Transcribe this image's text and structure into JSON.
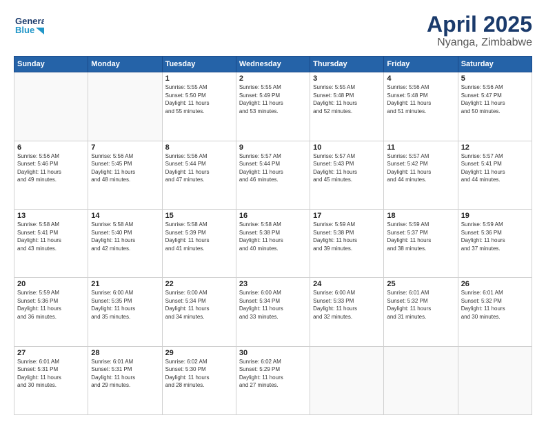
{
  "header": {
    "logo_line1": "General",
    "logo_line2": "Blue",
    "month": "April 2025",
    "location": "Nyanga, Zimbabwe"
  },
  "days_of_week": [
    "Sunday",
    "Monday",
    "Tuesday",
    "Wednesday",
    "Thursday",
    "Friday",
    "Saturday"
  ],
  "weeks": [
    [
      {
        "day": "",
        "content": ""
      },
      {
        "day": "",
        "content": ""
      },
      {
        "day": "1",
        "content": "Sunrise: 5:55 AM\nSunset: 5:50 PM\nDaylight: 11 hours\nand 55 minutes."
      },
      {
        "day": "2",
        "content": "Sunrise: 5:55 AM\nSunset: 5:49 PM\nDaylight: 11 hours\nand 53 minutes."
      },
      {
        "day": "3",
        "content": "Sunrise: 5:55 AM\nSunset: 5:48 PM\nDaylight: 11 hours\nand 52 minutes."
      },
      {
        "day": "4",
        "content": "Sunrise: 5:56 AM\nSunset: 5:48 PM\nDaylight: 11 hours\nand 51 minutes."
      },
      {
        "day": "5",
        "content": "Sunrise: 5:56 AM\nSunset: 5:47 PM\nDaylight: 11 hours\nand 50 minutes."
      }
    ],
    [
      {
        "day": "6",
        "content": "Sunrise: 5:56 AM\nSunset: 5:46 PM\nDaylight: 11 hours\nand 49 minutes."
      },
      {
        "day": "7",
        "content": "Sunrise: 5:56 AM\nSunset: 5:45 PM\nDaylight: 11 hours\nand 48 minutes."
      },
      {
        "day": "8",
        "content": "Sunrise: 5:56 AM\nSunset: 5:44 PM\nDaylight: 11 hours\nand 47 minutes."
      },
      {
        "day": "9",
        "content": "Sunrise: 5:57 AM\nSunset: 5:44 PM\nDaylight: 11 hours\nand 46 minutes."
      },
      {
        "day": "10",
        "content": "Sunrise: 5:57 AM\nSunset: 5:43 PM\nDaylight: 11 hours\nand 45 minutes."
      },
      {
        "day": "11",
        "content": "Sunrise: 5:57 AM\nSunset: 5:42 PM\nDaylight: 11 hours\nand 44 minutes."
      },
      {
        "day": "12",
        "content": "Sunrise: 5:57 AM\nSunset: 5:41 PM\nDaylight: 11 hours\nand 44 minutes."
      }
    ],
    [
      {
        "day": "13",
        "content": "Sunrise: 5:58 AM\nSunset: 5:41 PM\nDaylight: 11 hours\nand 43 minutes."
      },
      {
        "day": "14",
        "content": "Sunrise: 5:58 AM\nSunset: 5:40 PM\nDaylight: 11 hours\nand 42 minutes."
      },
      {
        "day": "15",
        "content": "Sunrise: 5:58 AM\nSunset: 5:39 PM\nDaylight: 11 hours\nand 41 minutes."
      },
      {
        "day": "16",
        "content": "Sunrise: 5:58 AM\nSunset: 5:38 PM\nDaylight: 11 hours\nand 40 minutes."
      },
      {
        "day": "17",
        "content": "Sunrise: 5:59 AM\nSunset: 5:38 PM\nDaylight: 11 hours\nand 39 minutes."
      },
      {
        "day": "18",
        "content": "Sunrise: 5:59 AM\nSunset: 5:37 PM\nDaylight: 11 hours\nand 38 minutes."
      },
      {
        "day": "19",
        "content": "Sunrise: 5:59 AM\nSunset: 5:36 PM\nDaylight: 11 hours\nand 37 minutes."
      }
    ],
    [
      {
        "day": "20",
        "content": "Sunrise: 5:59 AM\nSunset: 5:36 PM\nDaylight: 11 hours\nand 36 minutes."
      },
      {
        "day": "21",
        "content": "Sunrise: 6:00 AM\nSunset: 5:35 PM\nDaylight: 11 hours\nand 35 minutes."
      },
      {
        "day": "22",
        "content": "Sunrise: 6:00 AM\nSunset: 5:34 PM\nDaylight: 11 hours\nand 34 minutes."
      },
      {
        "day": "23",
        "content": "Sunrise: 6:00 AM\nSunset: 5:34 PM\nDaylight: 11 hours\nand 33 minutes."
      },
      {
        "day": "24",
        "content": "Sunrise: 6:00 AM\nSunset: 5:33 PM\nDaylight: 11 hours\nand 32 minutes."
      },
      {
        "day": "25",
        "content": "Sunrise: 6:01 AM\nSunset: 5:32 PM\nDaylight: 11 hours\nand 31 minutes."
      },
      {
        "day": "26",
        "content": "Sunrise: 6:01 AM\nSunset: 5:32 PM\nDaylight: 11 hours\nand 30 minutes."
      }
    ],
    [
      {
        "day": "27",
        "content": "Sunrise: 6:01 AM\nSunset: 5:31 PM\nDaylight: 11 hours\nand 30 minutes."
      },
      {
        "day": "28",
        "content": "Sunrise: 6:01 AM\nSunset: 5:31 PM\nDaylight: 11 hours\nand 29 minutes."
      },
      {
        "day": "29",
        "content": "Sunrise: 6:02 AM\nSunset: 5:30 PM\nDaylight: 11 hours\nand 28 minutes."
      },
      {
        "day": "30",
        "content": "Sunrise: 6:02 AM\nSunset: 5:29 PM\nDaylight: 11 hours\nand 27 minutes."
      },
      {
        "day": "",
        "content": ""
      },
      {
        "day": "",
        "content": ""
      },
      {
        "day": "",
        "content": ""
      }
    ]
  ]
}
